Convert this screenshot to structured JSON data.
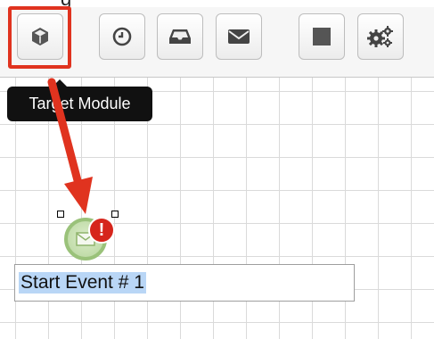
{
  "toolbar": {
    "buttons": [
      {
        "name": "target-module",
        "icon": "cube-icon"
      },
      {
        "name": "timer-event",
        "icon": "clock-icon"
      },
      {
        "name": "receive-message",
        "icon": "inbox-icon"
      },
      {
        "name": "send-message",
        "icon": "envelope-icon"
      },
      {
        "name": "end-event",
        "icon": "square-icon"
      },
      {
        "name": "settings",
        "icon": "gears-icon"
      }
    ],
    "highlight_color": "#e0331f"
  },
  "tooltip": {
    "text": "Target Module"
  },
  "diagram": {
    "start_event": {
      "label": "Start Event # 1",
      "icon": "envelope-icon",
      "warning_icon": "exclamation-icon",
      "warning_text": "!",
      "colors": {
        "ring": "#9ac27a",
        "warning": "#d6251c",
        "selection": "#b9d6f6"
      }
    }
  },
  "annotation": {
    "arrow_color": "#e0331f"
  }
}
